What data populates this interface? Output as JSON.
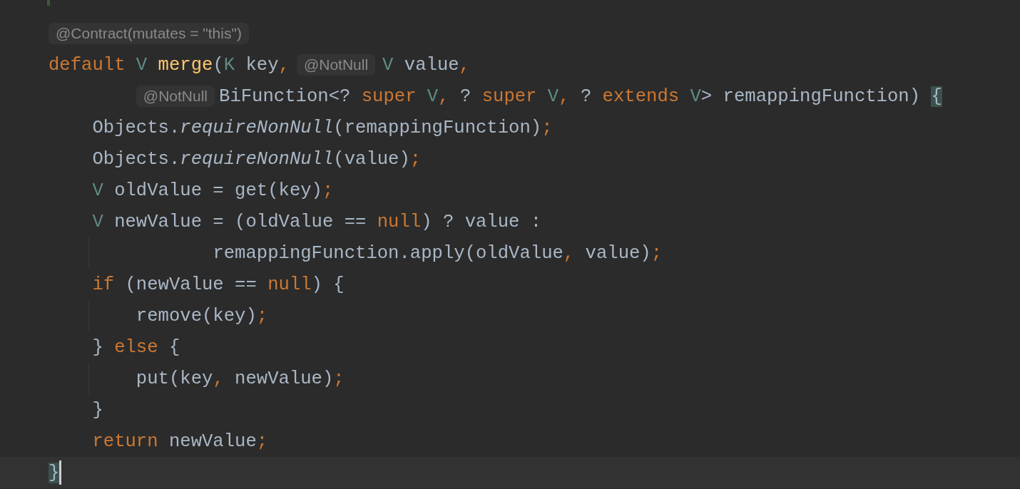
{
  "editor": {
    "lines": [
      {
        "kind": "code",
        "current": false,
        "tokens": [
          {
            "kind": "inlay",
            "text": "@Contract(mutates = \"this\")"
          }
        ]
      },
      {
        "kind": "code",
        "current": false,
        "tokens": [
          {
            "kind": "keyword",
            "text": "default"
          },
          {
            "kind": "type",
            "text": " V"
          },
          {
            "kind": "method",
            "text": " merge"
          },
          {
            "kind": "plain",
            "text": "("
          },
          {
            "kind": "type",
            "text": "K"
          },
          {
            "kind": "plain",
            "text": " key"
          },
          {
            "kind": "punct",
            "text": ","
          },
          {
            "kind": "inlay",
            "text": "@NotNull"
          },
          {
            "kind": "type",
            "text": "V"
          },
          {
            "kind": "plain",
            "text": " value"
          },
          {
            "kind": "punct",
            "text": ","
          }
        ],
        "children": [
          {
            "kind": "param",
            "current": false,
            "tokens": [
              {
                "kind": "inlay",
                "text": "@NotNull"
              },
              {
                "kind": "plain",
                "text": "BiFunction<?"
              },
              {
                "kind": "keyword",
                "text": " super"
              },
              {
                "kind": "type",
                "text": " V"
              },
              {
                "kind": "punct",
                "text": ","
              },
              {
                "kind": "plain",
                "text": " ?"
              },
              {
                "kind": "keyword",
                "text": " super"
              },
              {
                "kind": "type",
                "text": " V"
              },
              {
                "kind": "punct",
                "text": ","
              },
              {
                "kind": "plain",
                "text": " ?"
              },
              {
                "kind": "keyword",
                "text": " extends"
              },
              {
                "kind": "type",
                "text": " V"
              },
              {
                "kind": "plain",
                "text": "> remappingFunction) "
              },
              {
                "kind": "brace-match",
                "text": "{"
              }
            ]
          },
          {
            "kind": "code",
            "current": false,
            "tokens": [
              {
                "kind": "plain",
                "text": "Objects."
              },
              {
                "kind": "static",
                "text": "requireNonNull"
              },
              {
                "kind": "plain",
                "text": "(remappingFunction)"
              },
              {
                "kind": "punct",
                "text": ";"
              }
            ]
          },
          {
            "kind": "code",
            "current": false,
            "tokens": [
              {
                "kind": "plain",
                "text": "Objects."
              },
              {
                "kind": "static",
                "text": "requireNonNull"
              },
              {
                "kind": "plain",
                "text": "(value)"
              },
              {
                "kind": "punct",
                "text": ";"
              }
            ]
          },
          {
            "kind": "code",
            "current": false,
            "tokens": [
              {
                "kind": "type",
                "text": "V"
              },
              {
                "kind": "plain",
                "text": " oldValue = get(key)"
              },
              {
                "kind": "punct",
                "text": ";"
              }
            ]
          },
          {
            "kind": "code",
            "current": false,
            "tokens": [
              {
                "kind": "type",
                "text": "V"
              },
              {
                "kind": "plain",
                "text": " newValue = (oldValue =="
              },
              {
                "kind": "keyword",
                "text": " null"
              },
              {
                "kind": "plain",
                "text": ") ? value :"
              }
            ],
            "children": [
              {
                "kind": "wrap",
                "current": false,
                "tokens": [
                  {
                    "kind": "plain",
                    "text": "remappingFunction.apply(oldValue"
                  },
                  {
                    "kind": "punct",
                    "text": ","
                  },
                  {
                    "kind": "plain",
                    "text": " value)"
                  },
                  {
                    "kind": "punct",
                    "text": ";"
                  }
                ]
              }
            ]
          },
          {
            "kind": "code",
            "current": false,
            "tokens": [
              {
                "kind": "keyword",
                "text": "if"
              },
              {
                "kind": "plain",
                "text": " (newValue =="
              },
              {
                "kind": "keyword",
                "text": " null"
              },
              {
                "kind": "plain",
                "text": ") {"
              }
            ],
            "children": [
              {
                "kind": "code",
                "current": false,
                "tokens": [
                  {
                    "kind": "plain",
                    "text": "remove(key)"
                  },
                  {
                    "kind": "punct",
                    "text": ";"
                  }
                ]
              }
            ]
          },
          {
            "kind": "code",
            "current": false,
            "tokens": [
              {
                "kind": "plain",
                "text": "} "
              },
              {
                "kind": "keyword",
                "text": "else"
              },
              {
                "kind": "plain",
                "text": " {"
              }
            ],
            "children": [
              {
                "kind": "code",
                "current": false,
                "tokens": [
                  {
                    "kind": "plain",
                    "text": "put(key"
                  },
                  {
                    "kind": "punct",
                    "text": ","
                  },
                  {
                    "kind": "plain",
                    "text": " newValue)"
                  },
                  {
                    "kind": "punct",
                    "text": ";"
                  }
                ]
              }
            ]
          },
          {
            "kind": "code",
            "current": false,
            "tokens": [
              {
                "kind": "plain",
                "text": "}"
              }
            ]
          },
          {
            "kind": "code",
            "current": false,
            "tokens": [
              {
                "kind": "keyword",
                "text": "return"
              },
              {
                "kind": "plain",
                "text": " newValue"
              },
              {
                "kind": "punct",
                "text": ";"
              }
            ]
          }
        ]
      },
      {
        "kind": "code",
        "current": true,
        "tokens": [
          {
            "kind": "brace-match",
            "text": "}"
          }
        ]
      }
    ]
  }
}
